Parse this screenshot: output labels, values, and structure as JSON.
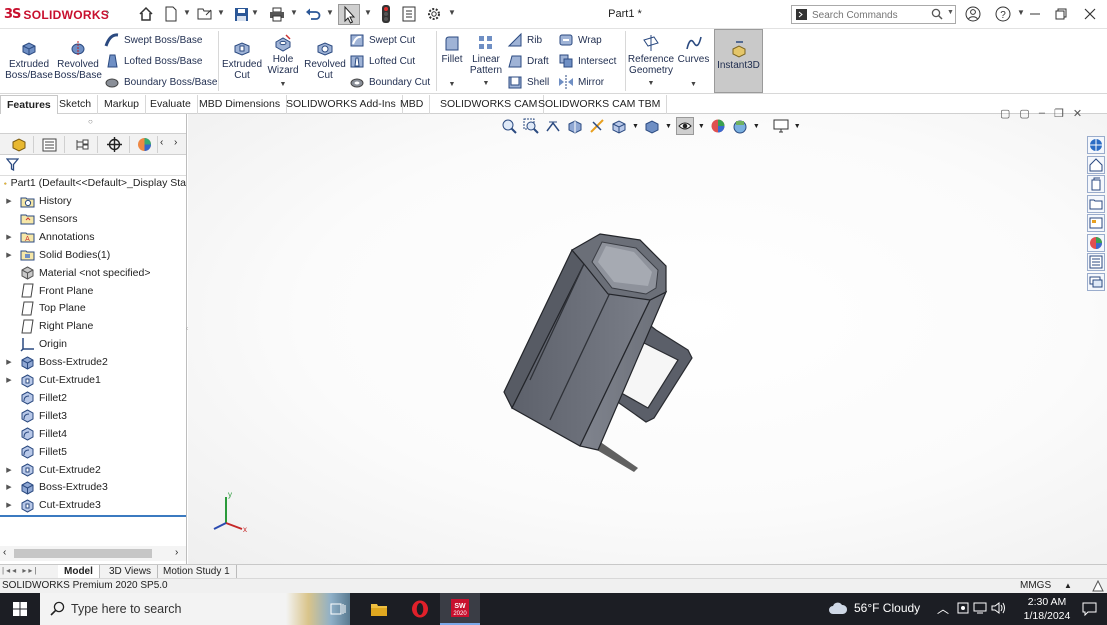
{
  "app": {
    "brand": "SOLIDWORKS",
    "document_title": "Part1 *",
    "search_placeholder": "Search Commands",
    "colors": {
      "brand_red": "#c8102e",
      "ribbon_text": "#1f2d4f",
      "part_gray": "#6b6f78",
      "taskbar": "#1c1e24"
    }
  },
  "quick_access": {
    "icons": [
      "home-icon",
      "new-document-icon",
      "open-icon",
      "save-icon",
      "print-icon",
      "undo-icon",
      "select-icon",
      "traffic-light-icon",
      "file-properties-icon",
      "options-gear-icon"
    ]
  },
  "title_controls": {
    "icons": [
      "search-icon",
      "user-icon",
      "help-icon",
      "minimize-icon",
      "restore-icon",
      "close-icon"
    ]
  },
  "ribbon": {
    "extruded_boss": "Extruded Boss/Base",
    "revolved_boss": "Revolved Boss/Base",
    "swept_boss": "Swept Boss/Base",
    "lofted_boss": "Lofted Boss/Base",
    "boundary_boss": "Boundary Boss/Base",
    "extruded_cut": "Extruded Cut",
    "hole_wizard": "Hole Wizard",
    "revolved_cut": "Revolved Cut",
    "swept_cut": "Swept Cut",
    "lofted_cut": "Lofted Cut",
    "boundary_cut": "Boundary Cut",
    "fillet": "Fillet",
    "linear_pattern": "Linear Pattern",
    "rib": "Rib",
    "draft": "Draft",
    "shell": "Shell",
    "wrap": "Wrap",
    "intersect": "Intersect",
    "mirror": "Mirror",
    "reference_geometry": "Reference Geometry",
    "curves": "Curves",
    "instant3d": "Instant3D"
  },
  "tabs": [
    "Features",
    "Sketch",
    "Markup",
    "Evaluate",
    "MBD Dimensions",
    "SOLIDWORKS Add-Ins",
    "MBD",
    "SOLIDWORKS CAM",
    "SOLIDWORKS CAM TBM"
  ],
  "feature_tree": {
    "root": "Part1  (Default<<Default>_Display Sta",
    "items": [
      {
        "label": "History",
        "icon": "history-folder-icon",
        "expandable": true
      },
      {
        "label": "Sensors",
        "icon": "sensors-icon",
        "expandable": false
      },
      {
        "label": "Annotations",
        "icon": "annotations-icon",
        "expandable": true
      },
      {
        "label": "Solid Bodies(1)",
        "icon": "solid-bodies-icon",
        "expandable": true
      },
      {
        "label": "Material <not specified>",
        "icon": "material-icon",
        "expandable": false
      },
      {
        "label": "Front Plane",
        "icon": "plane-icon",
        "expandable": false
      },
      {
        "label": "Top Plane",
        "icon": "plane-icon",
        "expandable": false
      },
      {
        "label": "Right Plane",
        "icon": "plane-icon",
        "expandable": false
      },
      {
        "label": "Origin",
        "icon": "origin-icon",
        "expandable": false
      },
      {
        "label": "Boss-Extrude2",
        "icon": "boss-extrude-icon",
        "expandable": true
      },
      {
        "label": "Cut-Extrude1",
        "icon": "cut-extrude-icon",
        "expandable": true
      },
      {
        "label": "Fillet2",
        "icon": "fillet-icon",
        "expandable": false
      },
      {
        "label": "Fillet3",
        "icon": "fillet-icon",
        "expandable": false
      },
      {
        "label": "Fillet4",
        "icon": "fillet-icon",
        "expandable": false
      },
      {
        "label": "Fillet5",
        "icon": "fillet-icon",
        "expandable": false
      },
      {
        "label": "Cut-Extrude2",
        "icon": "cut-extrude-icon",
        "expandable": true
      },
      {
        "label": "Boss-Extrude3",
        "icon": "boss-extrude-icon",
        "expandable": true
      },
      {
        "label": "Cut-Extrude3",
        "icon": "cut-extrude-icon",
        "expandable": true
      }
    ]
  },
  "triad": {
    "x": "x",
    "y": "y"
  },
  "bottom_tabs": [
    "Model",
    "3D Views",
    "Motion Study 1"
  ],
  "status": {
    "version": "SOLIDWORKS Premium 2020 SP5.0",
    "units": "MMGS"
  },
  "taskbar": {
    "search_placeholder": "Type here to search",
    "weather": "56°F  Cloudy",
    "time": "2:30 AM",
    "date": "1/18/2024",
    "sw_badge": "2020"
  }
}
